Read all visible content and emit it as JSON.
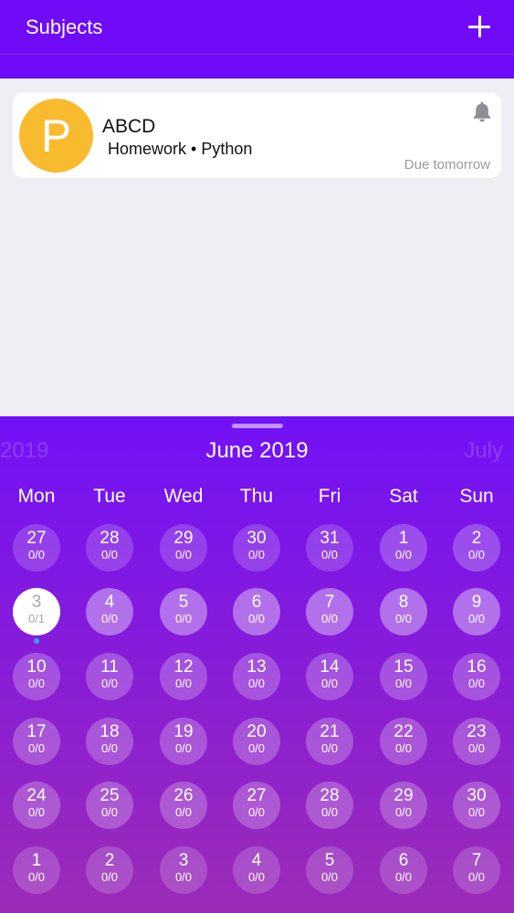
{
  "header": {
    "title": "Subjects",
    "add_icon": "plus-icon"
  },
  "task": {
    "avatar_letter": "P",
    "avatar_color": "#f8bb2f",
    "title": "ABCD",
    "subtitle": "Homework • Python",
    "due": "Due tomorrow",
    "reminder_icon": "bell-icon"
  },
  "calendar": {
    "prev_month": "2019",
    "current_month": "June 2019",
    "next_month": "July",
    "weekdays": [
      "Mon",
      "Tue",
      "Wed",
      "Thu",
      "Fri",
      "Sat",
      "Sun"
    ],
    "selected_date": "3",
    "weeks": [
      [
        {
          "day": "27",
          "count": "0/0"
        },
        {
          "day": "28",
          "count": "0/0"
        },
        {
          "day": "29",
          "count": "0/0"
        },
        {
          "day": "30",
          "count": "0/0"
        },
        {
          "day": "31",
          "count": "0/0"
        },
        {
          "day": "1",
          "count": "0/0"
        },
        {
          "day": "2",
          "count": "0/0"
        }
      ],
      [
        {
          "day": "3",
          "count": "0/1"
        },
        {
          "day": "4",
          "count": "0/0"
        },
        {
          "day": "5",
          "count": "0/0"
        },
        {
          "day": "6",
          "count": "0/0"
        },
        {
          "day": "7",
          "count": "0/0"
        },
        {
          "day": "8",
          "count": "0/0"
        },
        {
          "day": "9",
          "count": "0/0"
        }
      ],
      [
        {
          "day": "10",
          "count": "0/0"
        },
        {
          "day": "11",
          "count": "0/0"
        },
        {
          "day": "12",
          "count": "0/0"
        },
        {
          "day": "13",
          "count": "0/0"
        },
        {
          "day": "14",
          "count": "0/0"
        },
        {
          "day": "15",
          "count": "0/0"
        },
        {
          "day": "16",
          "count": "0/0"
        }
      ],
      [
        {
          "day": "17",
          "count": "0/0"
        },
        {
          "day": "18",
          "count": "0/0"
        },
        {
          "day": "19",
          "count": "0/0"
        },
        {
          "day": "20",
          "count": "0/0"
        },
        {
          "day": "21",
          "count": "0/0"
        },
        {
          "day": "22",
          "count": "0/0"
        },
        {
          "day": "23",
          "count": "0/0"
        }
      ],
      [
        {
          "day": "24",
          "count": "0/0"
        },
        {
          "day": "25",
          "count": "0/0"
        },
        {
          "day": "26",
          "count": "0/0"
        },
        {
          "day": "27",
          "count": "0/0"
        },
        {
          "day": "28",
          "count": "0/0"
        },
        {
          "day": "29",
          "count": "0/0"
        },
        {
          "day": "30",
          "count": "0/0"
        }
      ],
      [
        {
          "day": "1",
          "count": "0/0"
        },
        {
          "day": "2",
          "count": "0/0"
        },
        {
          "day": "3",
          "count": "0/0"
        },
        {
          "day": "4",
          "count": "0/0"
        },
        {
          "day": "5",
          "count": "0/0"
        },
        {
          "day": "6",
          "count": "0/0"
        },
        {
          "day": "7",
          "count": "0/0"
        }
      ]
    ]
  },
  "colors": {
    "header": "#6f0bf6",
    "calendar_top": "#7211f7",
    "calendar_bottom": "#9b2cb7",
    "event_dot": "#3aa0f5"
  }
}
